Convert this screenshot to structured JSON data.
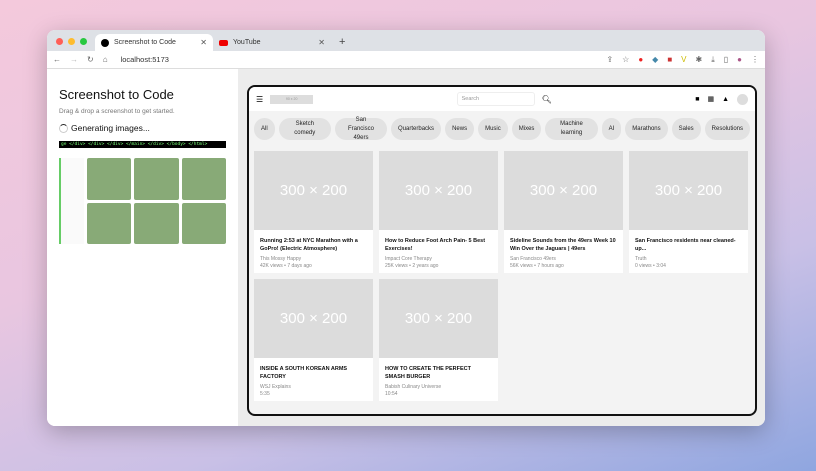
{
  "browser": {
    "tabs": [
      {
        "title": "Screenshot to Code",
        "active": true
      },
      {
        "title": "YouTube",
        "active": false
      }
    ],
    "url": "localhost:5173"
  },
  "app": {
    "title": "Screenshot to Code",
    "subtitle": "Drag & drop a screenshot to get started.",
    "status": "Generating images...",
    "code_stream": "ge </div> </div> </div> </main> </div> </body> </html>"
  },
  "preview": {
    "logo": "90 x 20",
    "search_placeholder": "Search",
    "chips": [
      "All",
      "Sketch comedy",
      "San Francisco 49ers",
      "Quarterbacks",
      "News",
      "Music",
      "Mixes",
      "Machine learning",
      "AI",
      "Marathons",
      "Sales",
      "Resolutions"
    ],
    "videos": [
      {
        "thumb": "300 × 200",
        "title": "Running 2:53 at NYC Marathon with a GoPro! (Electric Atmosphere)",
        "channel": "This Mossy Happy",
        "stats": "42K views • 7 days ago"
      },
      {
        "thumb": "300 × 200",
        "title": "How to Reduce Foot Arch Pain- 5 Best Exercises!",
        "channel": "Impact Core Therapy",
        "stats": "25K views • 2 years ago"
      },
      {
        "thumb": "300 × 200",
        "title": "Sideline Sounds from the 49ers Week 10 Win Over the Jaguars | 49ers",
        "channel": "San Francisco 49ers",
        "stats": "56K views • 7 hours ago"
      },
      {
        "thumb": "300 × 200",
        "title": "San Francisco residents near cleaned-up...",
        "channel": "Truth",
        "stats": "0 views • 3:04"
      },
      {
        "thumb": "300 × 200",
        "title": "INSIDE A SOUTH KOREAN ARMS FACTORY",
        "channel": "WSJ Explains",
        "stats": "5:35"
      },
      {
        "thumb": "300 × 200",
        "title": "HOW TO CREATE THE PERFECT SMASH BURGER",
        "channel": "Babish Culinary Universe",
        "stats": "10:54"
      }
    ]
  }
}
